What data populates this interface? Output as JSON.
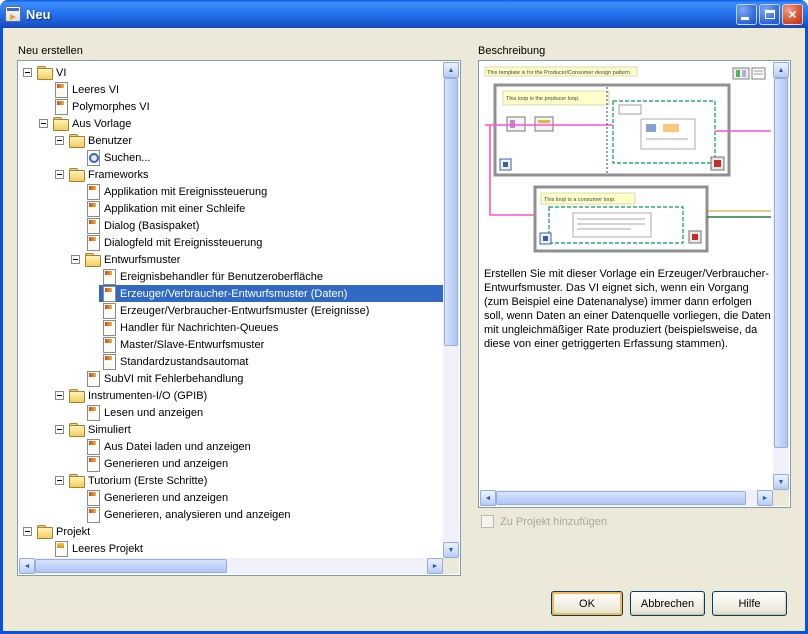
{
  "colors": {
    "selection": "#316AC5",
    "selection_text": "#FFFFFF",
    "titlebar_start": "#3E8CF8",
    "titlebar_mid": "#2472EE",
    "titlebar_end": "#174FC4",
    "window_border": "#0853DD",
    "dialog_bg": "#ECE9D8",
    "ok_focus_ring": "#F9B84F",
    "field_border": "#7F9DB9",
    "disabled_text": "#ACA899"
  },
  "window": {
    "title": "Neu"
  },
  "left_panel": {
    "label": "Neu erstellen",
    "tree_items": [
      {
        "label": "VI",
        "level": 0,
        "type": "folder",
        "expanded": true
      },
      {
        "label": "Leeres VI",
        "level": 1,
        "type": "vi"
      },
      {
        "label": "Polymorphes VI",
        "level": 1,
        "type": "vi"
      },
      {
        "label": "Aus Vorlage",
        "level": 1,
        "type": "folder",
        "expanded": true
      },
      {
        "label": "Benutzer",
        "level": 2,
        "type": "folder",
        "expanded": true
      },
      {
        "label": "Suchen...",
        "level": 3,
        "type": "search"
      },
      {
        "label": "Frameworks",
        "level": 2,
        "type": "folder",
        "expanded": true
      },
      {
        "label": "Applikation mit Ereignissteuerung",
        "level": 3,
        "type": "vi"
      },
      {
        "label": "Applikation mit einer Schleife",
        "level": 3,
        "type": "vi"
      },
      {
        "label": "Dialog (Basispaket)",
        "level": 3,
        "type": "vi"
      },
      {
        "label": "Dialogfeld mit Ereignissteuerung",
        "level": 3,
        "type": "vi"
      },
      {
        "label": "Entwurfsmuster",
        "level": 3,
        "type": "folder",
        "expanded": true
      },
      {
        "label": "Ereignisbehandler für Benutzeroberfläche",
        "level": 4,
        "type": "vi"
      },
      {
        "label": "Erzeuger/Verbraucher-Entwurfsmuster (Daten)",
        "level": 4,
        "type": "vi",
        "selected": true
      },
      {
        "label": "Erzeuger/Verbraucher-Entwurfsmuster (Ereignisse)",
        "level": 4,
        "type": "vi"
      },
      {
        "label": "Handler für Nachrichten-Queues",
        "level": 4,
        "type": "vi"
      },
      {
        "label": "Master/Slave-Entwurfsmuster",
        "level": 4,
        "type": "vi"
      },
      {
        "label": "Standardzustandsautomat",
        "level": 4,
        "type": "vi"
      },
      {
        "label": "SubVI mit Fehlerbehandlung",
        "level": 3,
        "type": "vi"
      },
      {
        "label": "Instrumenten-I/O (GPIB)",
        "level": 2,
        "type": "folder",
        "expanded": true
      },
      {
        "label": "Lesen und anzeigen",
        "level": 3,
        "type": "vi"
      },
      {
        "label": "Simuliert",
        "level": 2,
        "type": "folder",
        "expanded": true
      },
      {
        "label": "Aus Datei laden und anzeigen",
        "level": 3,
        "type": "vi"
      },
      {
        "label": "Generieren und anzeigen",
        "level": 3,
        "type": "vi"
      },
      {
        "label": "Tutorium (Erste Schritte)",
        "level": 2,
        "type": "folder",
        "expanded": true
      },
      {
        "label": "Generieren und anzeigen",
        "level": 3,
        "type": "vi"
      },
      {
        "label": "Generieren, analysieren und anzeigen",
        "level": 3,
        "type": "vi"
      },
      {
        "label": "Projekt",
        "level": 0,
        "type": "folder",
        "expanded": true
      },
      {
        "label": "Leeres Projekt",
        "level": 1,
        "type": "project"
      }
    ]
  },
  "right_panel": {
    "label": "Beschreibung",
    "preview_notes": {
      "header": "This template is for the Producer/Consumer design pattern.",
      "producer": "This loop is the producer loop.",
      "consumer": "This loop is a consumer loop."
    },
    "description": "Erstellen Sie mit dieser Vorlage ein Erzeuger/Verbraucher-Entwurfsmuster. Das VI eignet sich, wenn ein Vorgang (zum Beispiel eine Datenanalyse) immer dann erfolgen soll, wenn Daten an einer Datenquelle vorliegen, die Daten mit ungleichmäßiger Rate produziert (beispielsweise, da diese von einer getriggerten Erfassung stammen).",
    "project_checkbox": {
      "label": "Zu Projekt hinzufügen",
      "checked": false,
      "enabled": false
    }
  },
  "buttons": {
    "ok": "OK",
    "cancel": "Abbrechen",
    "help": "Hilfe"
  }
}
